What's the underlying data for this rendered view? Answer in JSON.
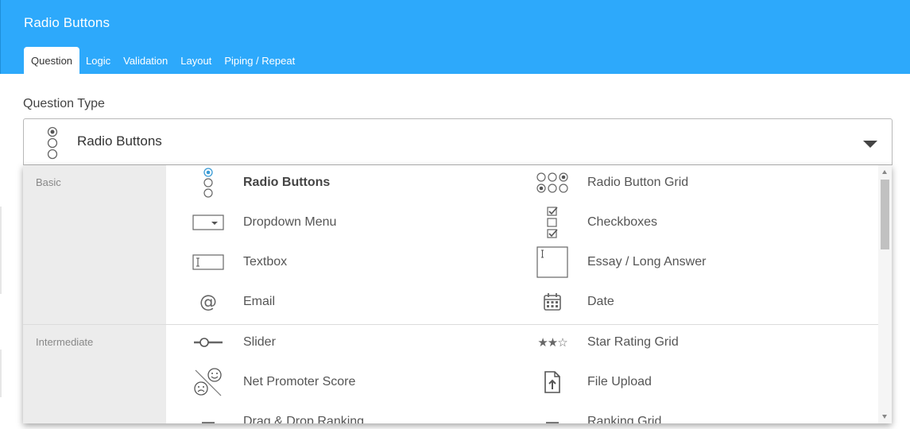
{
  "header": {
    "title": "Radio Buttons",
    "tabs": [
      {
        "label": "Question",
        "active": true
      },
      {
        "label": "Logic",
        "active": false
      },
      {
        "label": "Validation",
        "active": false
      },
      {
        "label": "Layout",
        "active": false
      },
      {
        "label": "Piping / Repeat",
        "active": false
      }
    ],
    "color": "#2da9fb"
  },
  "question_type": {
    "label": "Question Type",
    "selected": "Radio Buttons",
    "selected_icon": "radio-buttons-icon"
  },
  "dropdown": {
    "categories": [
      {
        "name": "Basic",
        "items": [
          {
            "label": "Radio Buttons",
            "icon": "radio-buttons-icon",
            "selected": true
          },
          {
            "label": "Radio Button Grid",
            "icon": "radio-grid-icon"
          },
          {
            "label": "Dropdown Menu",
            "icon": "dropdown-menu-icon"
          },
          {
            "label": "Checkboxes",
            "icon": "checkboxes-icon"
          },
          {
            "label": "Textbox",
            "icon": "textbox-icon"
          },
          {
            "label": "Essay / Long Answer",
            "icon": "essay-icon"
          },
          {
            "label": "Email",
            "icon": "at-sign-icon"
          },
          {
            "label": "Date",
            "icon": "calendar-icon"
          }
        ]
      },
      {
        "name": "Intermediate",
        "items": [
          {
            "label": "Slider",
            "icon": "slider-icon"
          },
          {
            "label": "Star Rating Grid",
            "icon": "star-rating-icon"
          },
          {
            "label": "Net Promoter Score",
            "icon": "nps-faces-icon"
          },
          {
            "label": "File Upload",
            "icon": "file-upload-icon"
          },
          {
            "label": "Drag & Drop Ranking",
            "icon": "ranking-icon"
          },
          {
            "label": "Ranking Grid",
            "icon": "ranking-grid-icon"
          }
        ]
      }
    ],
    "accent_color": "#3a9bd5"
  }
}
